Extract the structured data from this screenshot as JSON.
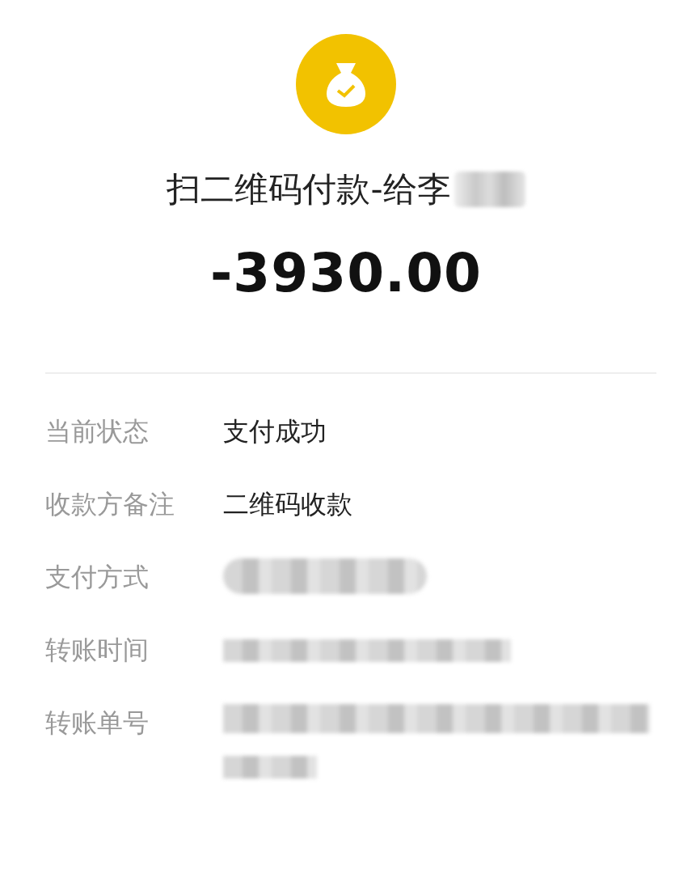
{
  "header": {
    "title": "扫二维码付款-给李",
    "title_redacted": true,
    "amount": "-3930.00"
  },
  "details": [
    {
      "label": "当前状态",
      "kind": "text",
      "value": "支付成功"
    },
    {
      "label": "收款方备注",
      "kind": "text",
      "value": "二维码收款"
    },
    {
      "label": "支付方式",
      "kind": "redacted-pill"
    },
    {
      "label": "转账时间",
      "kind": "redacted-line"
    },
    {
      "label": "转账单号",
      "kind": "redacted-block"
    }
  ]
}
